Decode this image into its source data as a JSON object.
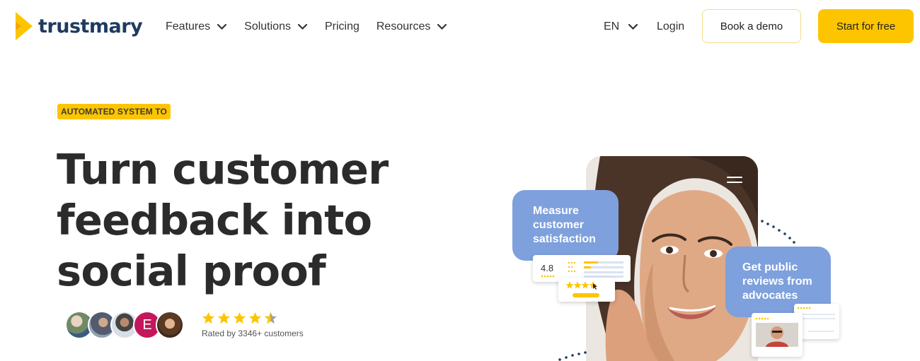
{
  "brand": {
    "name": "trustmary",
    "logo_color": "#fdc500",
    "text_color": "#1f3a5f"
  },
  "nav": {
    "items": [
      {
        "label": "Features",
        "has_dropdown": true
      },
      {
        "label": "Solutions",
        "has_dropdown": true
      },
      {
        "label": "Pricing",
        "has_dropdown": false
      },
      {
        "label": "Resources",
        "has_dropdown": true
      }
    ],
    "language": "EN",
    "login_label": "Login",
    "demo_label": "Book a demo",
    "start_label": "Start for free"
  },
  "hero": {
    "badge": "AUTOMATED SYSTEM TO",
    "title_lines": [
      "Turn customer",
      "feedback into",
      "social proof"
    ],
    "rating_text": "Rated by 3346+ customers",
    "rating_stars": 4.5,
    "avatar_initial": "E"
  },
  "illustration": {
    "bubble_left": [
      "Measure",
      "customer",
      "satisfaction"
    ],
    "bubble_right": [
      "Get public",
      "reviews from",
      "advocates"
    ],
    "score": "4.8"
  },
  "colors": {
    "accent": "#fdc500",
    "bubble": "#7ea0dc",
    "badge_avatar": "#c4175b"
  }
}
